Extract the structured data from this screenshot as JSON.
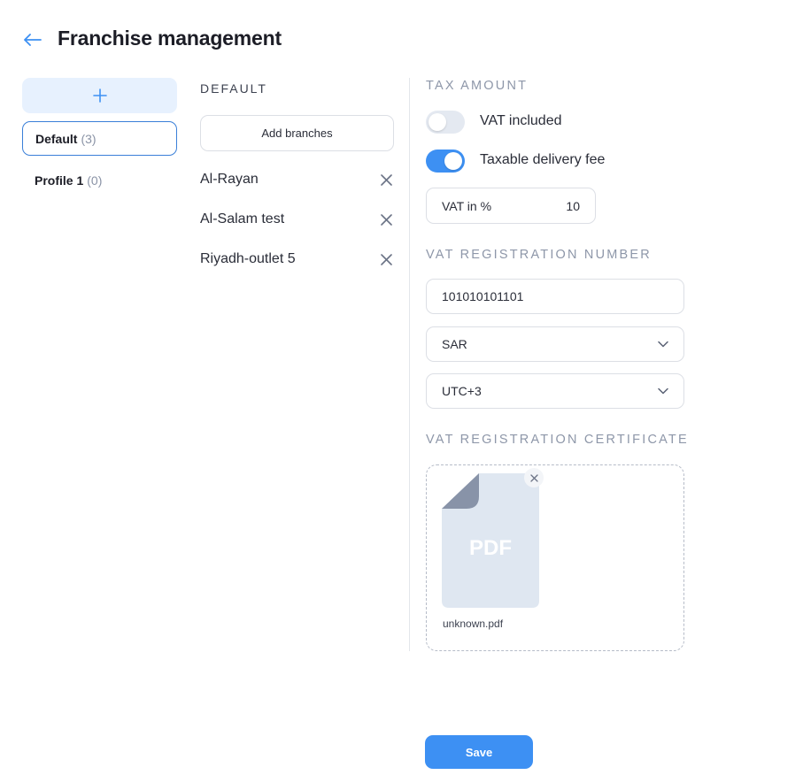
{
  "header": {
    "title": "Franchise management",
    "back_icon": "arrow-left-icon"
  },
  "profiles": {
    "add_icon": "plus-icon",
    "items": [
      {
        "label": "Default",
        "count": "(3)",
        "active": true
      },
      {
        "label": "Profile 1",
        "count": "(0)",
        "active": false
      }
    ]
  },
  "branches": {
    "section_title": "DEFAULT",
    "add_button": "Add branches",
    "items": [
      {
        "name": "Al-Rayan"
      },
      {
        "name": "Al-Salam test"
      },
      {
        "name": "Riyadh-outlet 5"
      }
    ],
    "remove_icon": "close-icon"
  },
  "tax": {
    "section_title": "TAX AMOUNT",
    "vat_included": {
      "label": "VAT included",
      "on": false
    },
    "taxable_delivery": {
      "label": "Taxable delivery fee",
      "on": true
    },
    "vat_percent": {
      "label": "VAT in %",
      "value": "10"
    }
  },
  "vat_registration": {
    "section_title": "VAT REGISTRATION NUMBER",
    "number": "101010101101",
    "currency": "SAR",
    "timezone": "UTC+3"
  },
  "certificate": {
    "section_title": "VAT REGISTRATION CERTIFICATE",
    "file_badge": "PDF",
    "file_name": "unknown.pdf"
  },
  "footer": {
    "save_label": "Save"
  },
  "colors": {
    "accent": "#3d90f3",
    "muted": "#8e97a9",
    "file_bg": "#dfe7f1",
    "file_fold": "#8893a8"
  }
}
